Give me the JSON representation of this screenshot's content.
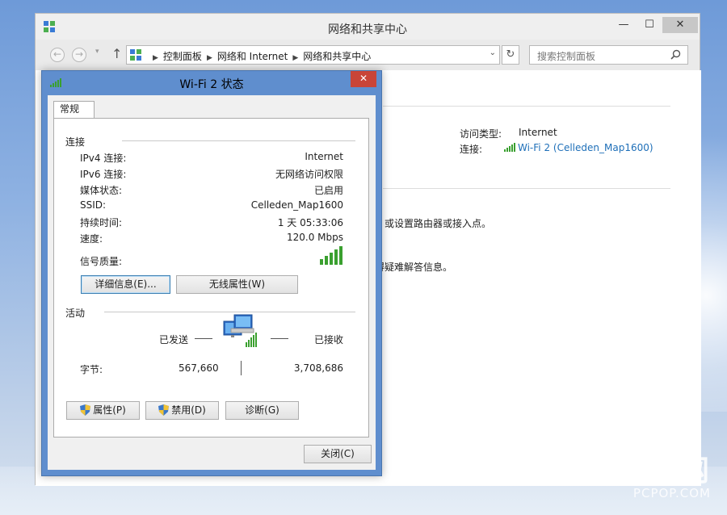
{
  "main_window": {
    "title": "网络和共享中心",
    "controls": {
      "minimize": "—",
      "maximize": "☐",
      "close": "✕"
    },
    "breadcrumbs": [
      "控制面板",
      "网络和 Internet",
      "网络和共享中心"
    ],
    "search_placeholder": "搜索控制面板",
    "access_type_label": "访问类型:",
    "access_type_value": "Internet",
    "connections_label": "连接:",
    "connection_link": "Wi-Fi 2 (Celleden_Map1600)",
    "text_fragment_1": "；或设置路由器或接入点。",
    "text_fragment_2": "得疑难解答信息。"
  },
  "dialog": {
    "title": "Wi-Fi 2 状态",
    "close": "✕",
    "tab": "常规",
    "connection_section": "连接",
    "rows": [
      {
        "label": "IPv4 连接:",
        "value": "Internet"
      },
      {
        "label": "IPv6 连接:",
        "value": "无网络访问权限"
      },
      {
        "label": "媒体状态:",
        "value": "已启用"
      },
      {
        "label": "SSID:",
        "value": "Celleden_Map1600"
      },
      {
        "label": "持续时间:",
        "value": "1 天 05:33:06"
      },
      {
        "label": "速度:",
        "value": "120.0 Mbps"
      }
    ],
    "signal_label": "信号质量:",
    "signal_bars": 5,
    "details_button": "详细信息(E)...",
    "wireless_props_button": "无线属性(W)",
    "activity_section": "活动",
    "sent_label": "已发送",
    "received_label": "已接收",
    "bytes_label": "字节:",
    "bytes_sent": "567,660",
    "bytes_received": "3,708,686",
    "properties_button": "属性(P)",
    "disable_button": "禁用(D)",
    "diagnose_button": "诊断(G)",
    "close_button": "关闭(C)"
  },
  "watermark": {
    "main": "泡泡网",
    "sub": "PCPOP.COM"
  },
  "colors": {
    "link": "#1e6fb8",
    "dialog_frame": "#5f8ece",
    "close_red": "#c94538",
    "signal_green": "#3aa02f"
  }
}
